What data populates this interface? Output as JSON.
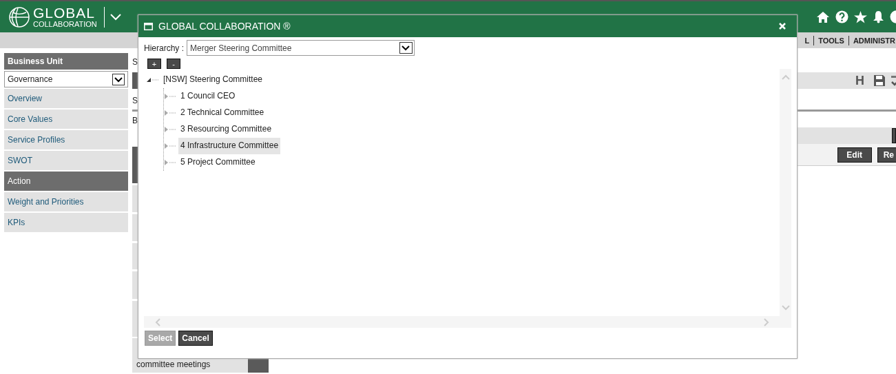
{
  "header": {
    "logo": {
      "title": "GLOBAL",
      "subtitle": "COLLABORATION"
    }
  },
  "top_nav": [
    {
      "label": "L"
    },
    {
      "label": "TOOLS"
    },
    {
      "label": "ADMINISTR"
    }
  ],
  "sidebar": {
    "title": "Business Unit",
    "business_unit": {
      "value": "Governance"
    },
    "items": [
      {
        "label": "Overview",
        "selected": false
      },
      {
        "label": "Core Values",
        "selected": false
      },
      {
        "label": "Service Profiles",
        "selected": false
      },
      {
        "label": "SWOT",
        "selected": false
      },
      {
        "label": "Action",
        "selected": true
      },
      {
        "label": "Weight and Priorities",
        "selected": false
      },
      {
        "label": "KPIs",
        "selected": false
      }
    ]
  },
  "page": {
    "fragments": [
      "S",
      "S",
      "B"
    ],
    "toolbar_text": "H",
    "last_row_text": "committee meetings",
    "row_buttons": [
      "Edit",
      "Re"
    ]
  },
  "dialog": {
    "title": "GLOBAL COLLABORATION ®",
    "hierarchy": {
      "label": "Hierarchy :",
      "value": "Merger Steering Committee"
    },
    "expand_all": "+",
    "collapse_all": "-",
    "tree": [
      {
        "label": "[NSW] Steering Committee",
        "expanded": true,
        "selected": false,
        "children": [
          {
            "label": "1 Council CEO",
            "expanded": false,
            "selected": false
          },
          {
            "label": "2 Technical Committee",
            "expanded": false,
            "selected": false
          },
          {
            "label": "3 Resourcing Committee",
            "expanded": false,
            "selected": false
          },
          {
            "label": "4 Infrastructure Committee",
            "expanded": false,
            "selected": true
          },
          {
            "label": "5 Project Committee",
            "expanded": false,
            "selected": false
          }
        ]
      }
    ],
    "actions": [
      {
        "label": "Select",
        "disabled": true
      },
      {
        "label": "Cancel",
        "disabled": false
      }
    ]
  }
}
